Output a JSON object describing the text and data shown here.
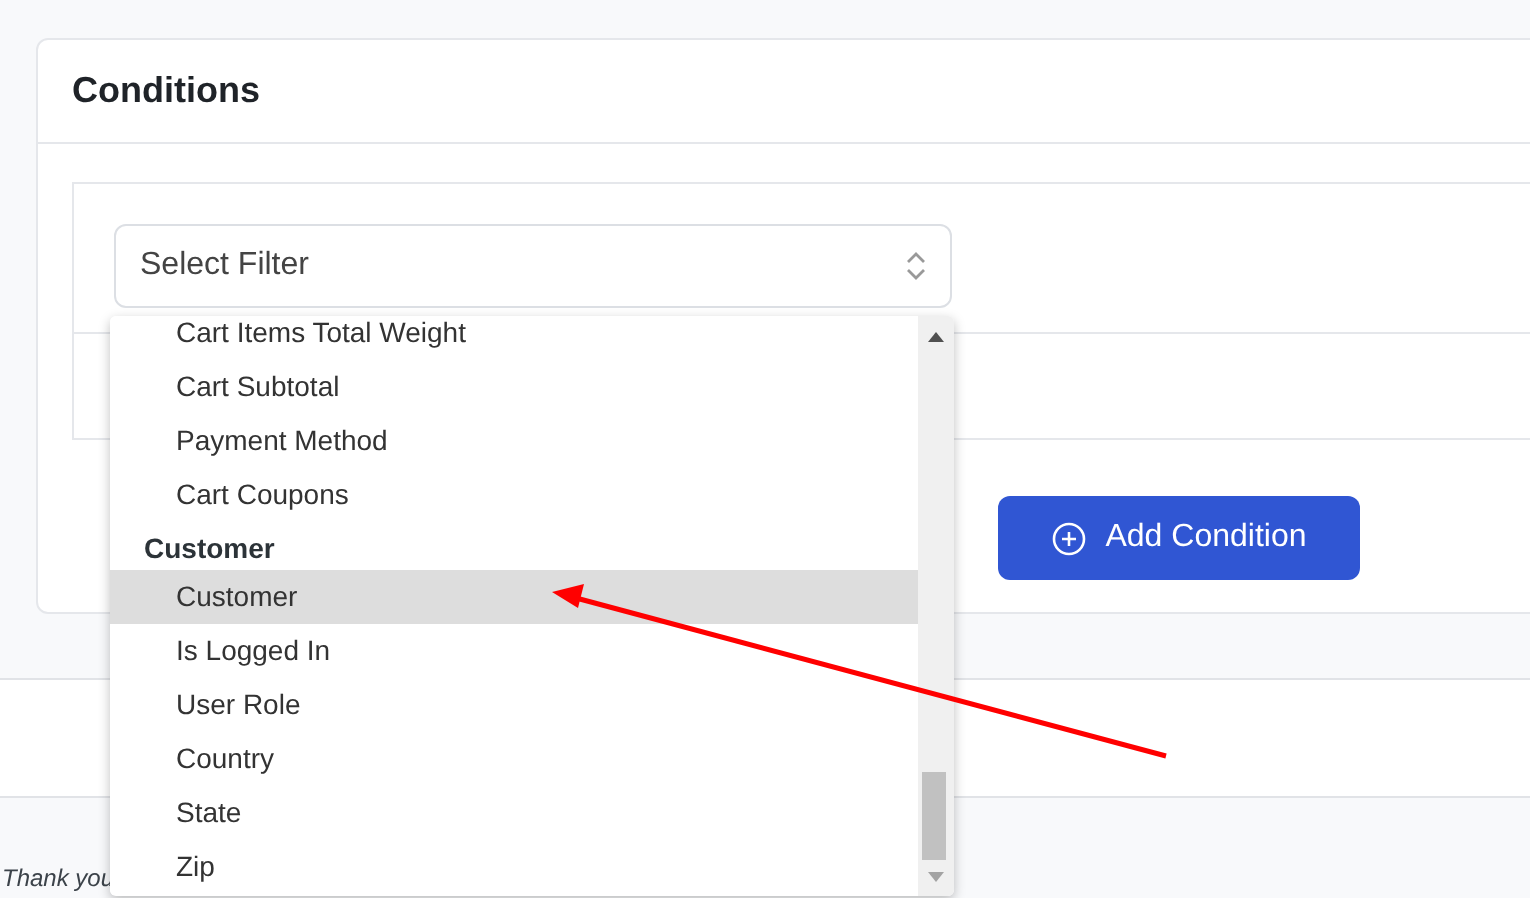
{
  "card": {
    "title": "Conditions"
  },
  "filter_select": {
    "placeholder": "Select Filter"
  },
  "dropdown": {
    "items": [
      {
        "kind": "option",
        "label": "Cart Items Total Weight",
        "selected": false
      },
      {
        "kind": "option",
        "label": "Cart Subtotal",
        "selected": false
      },
      {
        "kind": "option",
        "label": "Payment Method",
        "selected": false
      },
      {
        "kind": "option",
        "label": "Cart Coupons",
        "selected": false
      },
      {
        "kind": "group",
        "label": "Customer"
      },
      {
        "kind": "option",
        "label": "Customer",
        "selected": true
      },
      {
        "kind": "option",
        "label": "Is Logged In",
        "selected": false
      },
      {
        "kind": "option",
        "label": "User Role",
        "selected": false
      },
      {
        "kind": "option",
        "label": "Country",
        "selected": false
      },
      {
        "kind": "option",
        "label": "State",
        "selected": false
      },
      {
        "kind": "option",
        "label": "Zip",
        "selected": false
      }
    ]
  },
  "add_button": {
    "label": "Add Condition"
  },
  "footer": {
    "text": "Thank you"
  }
}
